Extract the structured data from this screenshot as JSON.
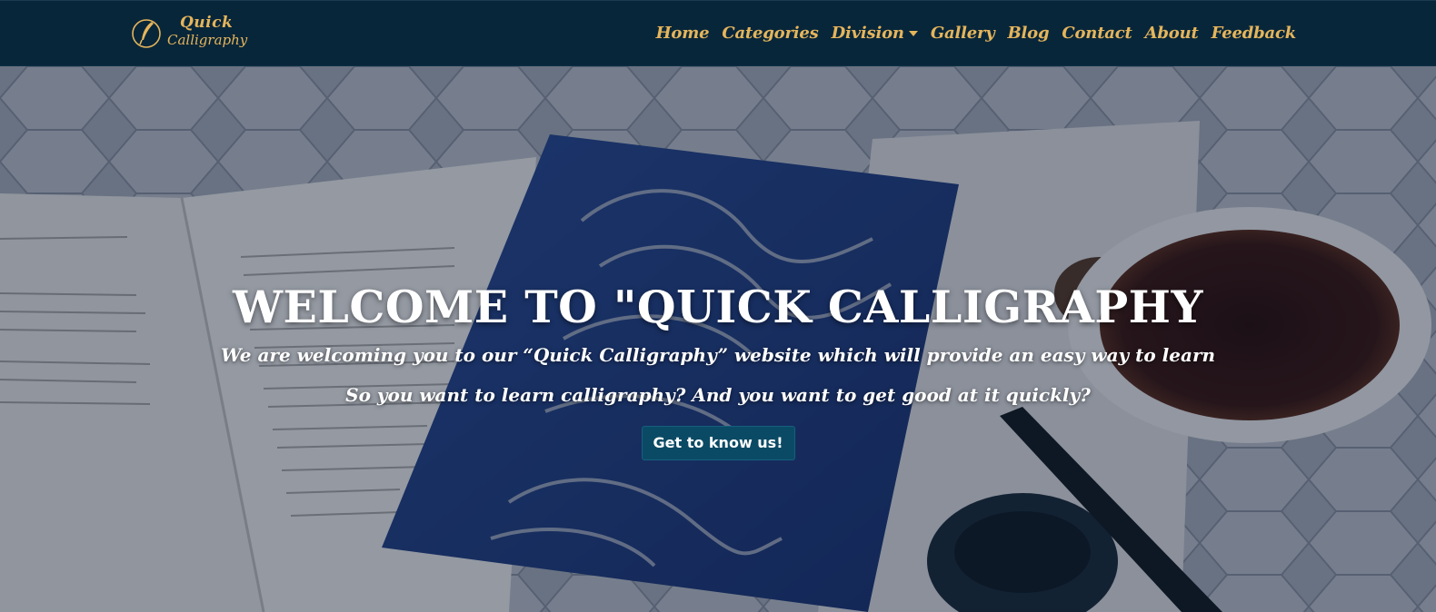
{
  "brand": {
    "line1": "Quick",
    "line2": "Calligraphy",
    "icon": "quill-pen-icon",
    "color": "#e5b55b"
  },
  "nav": {
    "home": "Home",
    "categories": "Categories",
    "division": "Division",
    "gallery": "Gallery",
    "blog": "Blog",
    "contact": "Contact",
    "about": "About",
    "feedback": "Feedback"
  },
  "hero": {
    "title": "WELCOME TO \"QUICK CALLIGRAPHY",
    "subtitle1": "We are welcoming you to our “Quick Calligraphy” website which will provide an easy way to learn",
    "subtitle2": "So you want to learn calligraphy? And you want to get good at it quickly?",
    "button": "Get to know us!",
    "button_color": "#0b4a64"
  },
  "colors": {
    "navbar_bg": "#08263a",
    "accent_gold": "#e5b55b"
  }
}
